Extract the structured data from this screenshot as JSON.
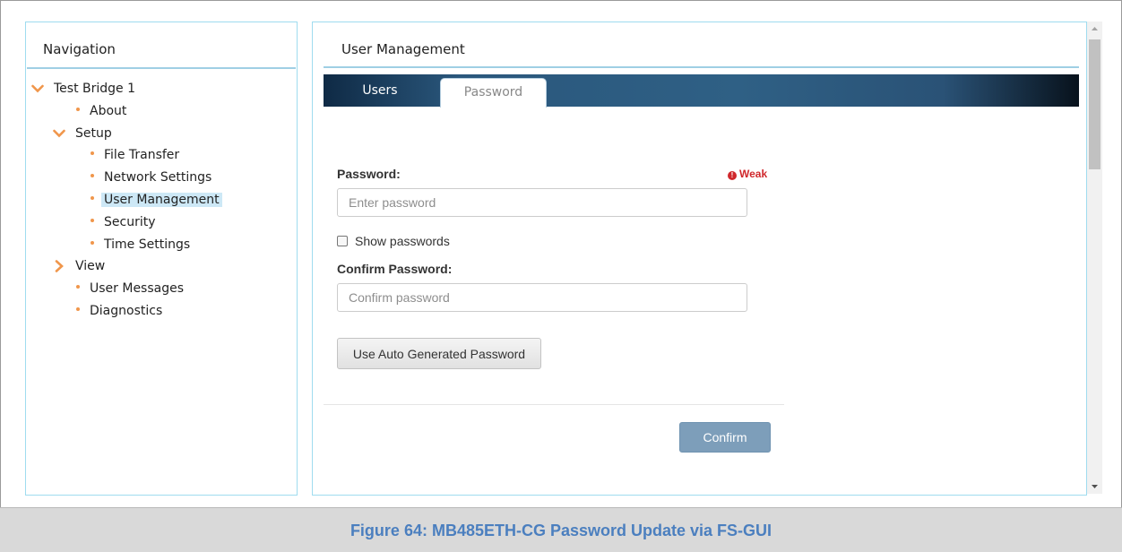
{
  "navigation": {
    "title": "Navigation",
    "tree": [
      {
        "label": "Test Bridge 1",
        "kind": "expanded",
        "level": 0
      },
      {
        "label": "About",
        "kind": "bullet",
        "level": 1
      },
      {
        "label": "Setup",
        "kind": "expanded",
        "level": 1
      },
      {
        "label": "File Transfer",
        "kind": "bullet",
        "level": 2
      },
      {
        "label": "Network Settings",
        "kind": "bullet",
        "level": 2
      },
      {
        "label": "User Management",
        "kind": "bullet",
        "level": 2,
        "selected": true
      },
      {
        "label": "Security",
        "kind": "bullet",
        "level": 2
      },
      {
        "label": "Time Settings",
        "kind": "bullet",
        "level": 2
      },
      {
        "label": "View",
        "kind": "collapsed",
        "level": 1
      },
      {
        "label": "User Messages",
        "kind": "bullet",
        "level": 1
      },
      {
        "label": "Diagnostics",
        "kind": "bullet",
        "level": 1
      }
    ]
  },
  "main": {
    "title": "User Management",
    "tabs": [
      {
        "label": "Users",
        "active": false
      },
      {
        "label": "Password",
        "active": true
      }
    ],
    "password": {
      "label": "Password:",
      "strength": "Weak",
      "strength_icon": "exclamation-icon",
      "placeholder": "Enter password",
      "value": ""
    },
    "show_passwords": {
      "label": "Show passwords",
      "checked": false
    },
    "confirm_password": {
      "label": "Confirm Password:",
      "placeholder": "Confirm password",
      "value": ""
    },
    "auto_button": "Use Auto Generated Password",
    "confirm_button": "Confirm"
  },
  "caption": "Figure 64: MB485ETH-CG Password Update via FS-GUI",
  "colors": {
    "accent_orange": "#f0964b",
    "panel_border": "#9fdcef",
    "selected_bg": "#cde8f6",
    "weak_red": "#d0282c",
    "confirm_button": "#7d9eba",
    "caption_text": "#4b7fbf"
  }
}
